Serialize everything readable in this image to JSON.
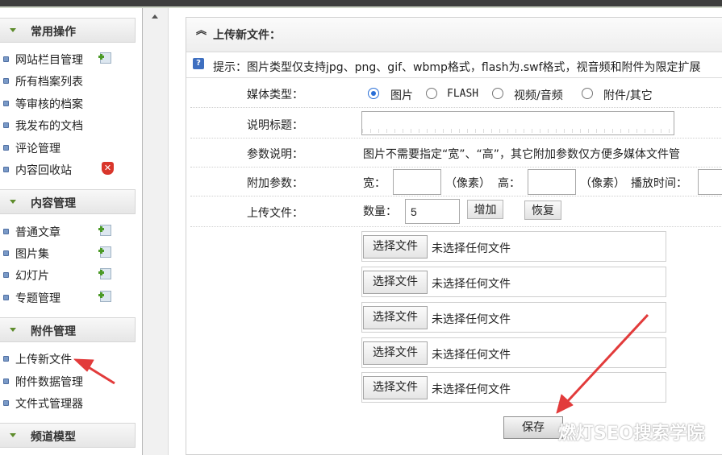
{
  "sidebar": {
    "sections": [
      {
        "title": "常用操作",
        "items": [
          {
            "label": "网站栏目管理",
            "icon": "add-icon"
          },
          {
            "label": "所有档案列表",
            "icon": ""
          },
          {
            "label": "等审核的档案",
            "icon": ""
          },
          {
            "label": "我发布的文档",
            "icon": ""
          },
          {
            "label": "评论管理",
            "icon": ""
          },
          {
            "label": "内容回收站",
            "icon": "delete-icon"
          }
        ]
      },
      {
        "title": "内容管理",
        "items": [
          {
            "label": "普通文章",
            "icon": "add-icon"
          },
          {
            "label": "图片集",
            "icon": "add-icon"
          },
          {
            "label": "幻灯片",
            "icon": "add-icon"
          },
          {
            "label": "专题管理",
            "icon": "add-icon"
          }
        ]
      },
      {
        "title": "附件管理",
        "items": [
          {
            "label": "上传新文件",
            "icon": ""
          },
          {
            "label": "附件数据管理",
            "icon": ""
          },
          {
            "label": "文件式管理器",
            "icon": ""
          }
        ]
      },
      {
        "title": "频道模型",
        "items": []
      }
    ]
  },
  "panel": {
    "title": "上传新文件：",
    "tip": "提示：图片类型仅支持jpg、png、gif、wbmp格式，flash为.swf格式，视音频和附件为限定扩展"
  },
  "form": {
    "media_type": {
      "label": "媒体类型：",
      "options": [
        "图片",
        "FLASH",
        "视频/音频",
        "附件/其它"
      ],
      "selected": "图片"
    },
    "title_field": {
      "label": "说明标题：",
      "value": ""
    },
    "params_note": {
      "label": "参数说明：",
      "text": "图片不需要指定“宽”、“高”，其它附加参数仅方便多媒体文件管"
    },
    "extra_params": {
      "label": "附加参数：",
      "width_label": "宽：",
      "height_label": "高：",
      "unit": "（像素）",
      "duration_label": "播放时间：",
      "width_value": "",
      "height_value": "",
      "duration_value": ""
    },
    "upload": {
      "label": "上传文件：",
      "count_label": "数量：",
      "count_value": "5",
      "add_label": "增加",
      "reset_label": "恢复"
    },
    "files": [
      {
        "button": "选择文件",
        "status": "未选择任何文件"
      },
      {
        "button": "选择文件",
        "status": "未选择任何文件"
      },
      {
        "button": "选择文件",
        "status": "未选择任何文件"
      },
      {
        "button": "选择文件",
        "status": "未选择任何文件"
      },
      {
        "button": "选择文件",
        "status": "未选择任何文件"
      }
    ],
    "save_label": "保存"
  },
  "watermark": "燃灯SEO搜索学院",
  "colors": {
    "top_bar": "#3e3e3e",
    "section_arrow": "#5e8c2c",
    "annotation_arrow": "#e23b3b",
    "radio_selected": "#2a6fd6"
  }
}
